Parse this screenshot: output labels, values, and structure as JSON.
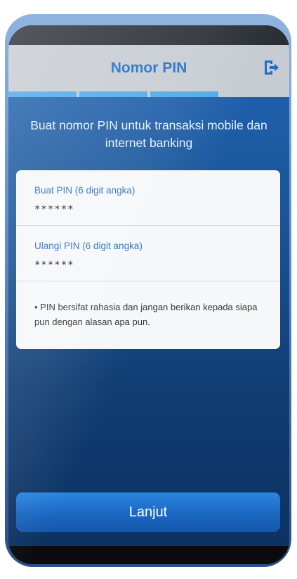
{
  "header": {
    "title": "Nomor PIN",
    "logout_icon": "logout-icon"
  },
  "progress": {
    "total_steps": 4,
    "completed_steps": 3
  },
  "main": {
    "instruction": "Buat nomor PIN untuk transaksi mobile dan internet banking",
    "fields": [
      {
        "label": "Buat PIN (6 digit angka)",
        "value": "******"
      },
      {
        "label": "Ulangi PIN (6 digit angka)",
        "value": "******"
      }
    ],
    "note": "• PIN bersifat rahasia dan jangan berikan kepada siapa pun dengan alasan apa pun."
  },
  "footer": {
    "continue_label": "Lanjut"
  },
  "colors": {
    "accent": "#1f6fc4",
    "progress": "#4fa9e6",
    "background": "#195393",
    "button": "#1b67c2"
  }
}
